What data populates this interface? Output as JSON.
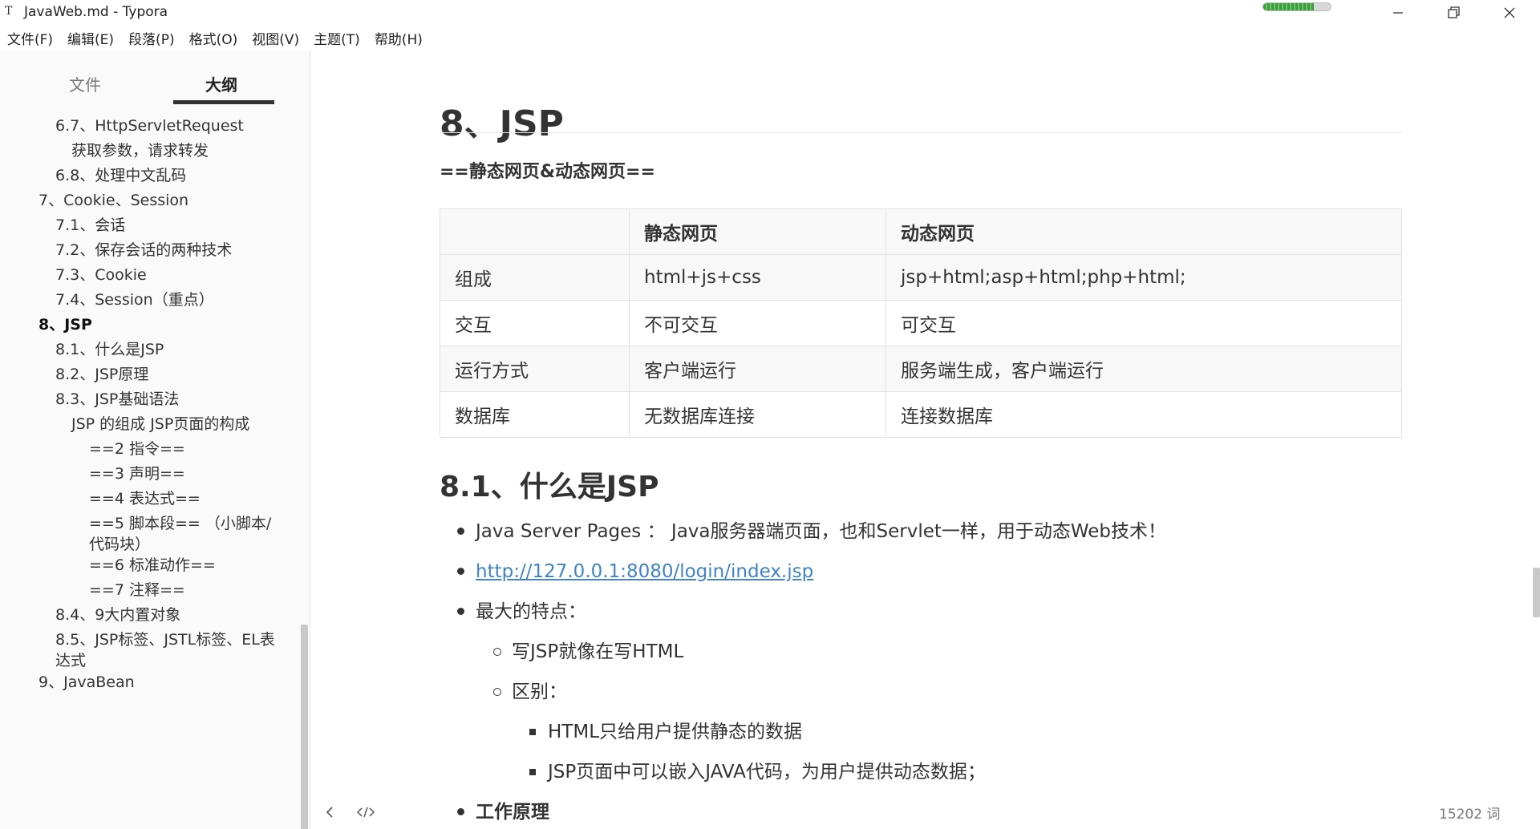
{
  "window": {
    "title": "JavaWeb.md - Typora",
    "app_icon": "T",
    "progress": 0.75
  },
  "menu": [
    "文件(F)",
    "编辑(E)",
    "段落(P)",
    "格式(O)",
    "视图(V)",
    "主题(T)",
    "帮助(H)"
  ],
  "sidebar": {
    "tabs": {
      "files": "文件",
      "outline": "大纲"
    },
    "outline": [
      {
        "label": "6.7、HttpServletRequest",
        "level": 2
      },
      {
        "label": "获取参数，请求转发",
        "level": 3
      },
      {
        "label": "6.8、处理中文乱码",
        "level": 2
      },
      {
        "label": "7、Cookie、Session",
        "level": 1
      },
      {
        "label": "7.1、会话",
        "level": 2
      },
      {
        "label": "7.2、保存会话的两种技术",
        "level": 2
      },
      {
        "label": "7.3、Cookie",
        "level": 2
      },
      {
        "label": "7.4、Session（重点）",
        "level": 2
      },
      {
        "label": "8、JSP",
        "level": 1,
        "active": true
      },
      {
        "label": "8.1、什么是JSP",
        "level": 2
      },
      {
        "label": "8.2、JSP原理",
        "level": 2
      },
      {
        "label": "8.3、JSP基础语法",
        "level": 2
      },
      {
        "label": "JSP 的组成 JSP页面的构成",
        "level": 3
      },
      {
        "label": "==2 指令==",
        "level": 4
      },
      {
        "label": "==3 声明==",
        "level": 4
      },
      {
        "label": "==4 表达式==",
        "level": 4
      },
      {
        "label": "==5 脚本段== （小脚本/代码块）",
        "level": 4
      },
      {
        "label": "==6 标准动作==",
        "level": 4
      },
      {
        "label": "==7 注释==",
        "level": 4
      },
      {
        "label": "8.4、9大内置对象",
        "level": 2
      },
      {
        "label": "8.5、JSP标签、JSTL标签、EL表达式",
        "level": 2
      },
      {
        "label": "9、JavaBean",
        "level": 1
      }
    ]
  },
  "document": {
    "heading": "8、JSP",
    "subtitle": "==静态网页&动态网页==",
    "table": {
      "headers": [
        "",
        "静态网页",
        "动态网页"
      ],
      "rows": [
        [
          "组成",
          "html+js+css",
          "jsp+html;asp+html;php+html;"
        ],
        [
          "交互",
          "不可交互",
          "可交互"
        ],
        [
          "运行方式",
          "客户端运行",
          "服务端生成，客户端运行"
        ],
        [
          "数据库",
          "无数据库连接",
          "连接数据库"
        ]
      ]
    },
    "subheading": "8.1、什么是JSP",
    "list": {
      "item1": "Java Server Pages ：  Java服务器端页面，也和Servlet一样，用于动态Web技术！",
      "link": "http://127.0.0.1:8080/login/index.jsp",
      "item3": "最大的特点：",
      "sub1": "写JSP就像在写HTML",
      "sub2": "区别：",
      "subsub1": "HTML只给用户提供静态的数据",
      "subsub2": "JSP页面中可以嵌入JAVA代码，为用户提供动态数据；",
      "item4": "工作原理"
    }
  },
  "footer": {
    "word_count": "15202 词",
    "toggle_sidebar_icon": "chevron-left-icon",
    "source_mode_icon": "code-icon"
  }
}
